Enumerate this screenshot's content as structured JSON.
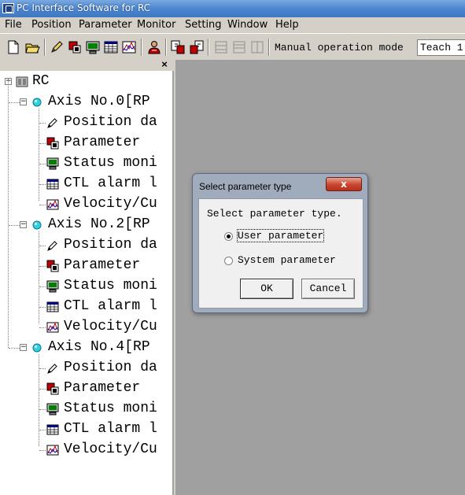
{
  "window": {
    "title": "PC Interface Software for RC"
  },
  "menu": [
    "File",
    "Position",
    "Parameter",
    "Monitor",
    "Setting",
    "Window",
    "Help"
  ],
  "toolbar": {
    "mode_label": "Manual operation mode",
    "mode_value": "Teach 1"
  },
  "tree": {
    "close_glyph": "×",
    "root": "RC",
    "axes": [
      {
        "label": "Axis No.0[RP",
        "children": [
          "Position da",
          "Parameter",
          "Status moni",
          "CTL alarm l",
          "Velocity/Cu"
        ]
      },
      {
        "label": "Axis No.2[RP",
        "children": [
          "Position da",
          "Parameter",
          "Status moni",
          "CTL alarm l",
          "Velocity/Cu"
        ]
      },
      {
        "label": "Axis No.4[RP",
        "children": [
          "Position da",
          "Parameter",
          "Status moni",
          "CTL alarm l",
          "Velocity/Cu"
        ]
      }
    ],
    "child_icons": [
      "pencil-icon",
      "parameter-icon",
      "monitor-icon",
      "alarm-table-icon",
      "graph-icon"
    ]
  },
  "dialog": {
    "title": "Select parameter type",
    "close_glyph": "x",
    "prompt": "Select parameter type.",
    "options": [
      {
        "label": "User parameter",
        "selected": true
      },
      {
        "label": "System parameter",
        "selected": false
      }
    ],
    "ok_label": "OK",
    "cancel_label": "Cancel"
  }
}
